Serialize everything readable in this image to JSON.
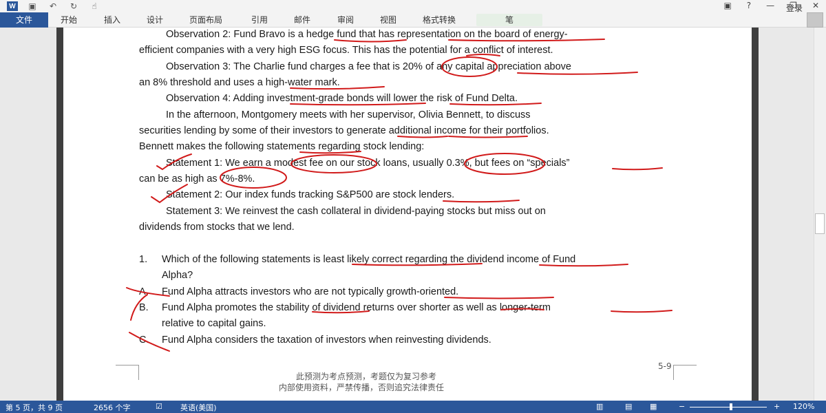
{
  "window": {
    "word_icon": "W",
    "qat_icons": [
      "save-icon",
      "undo-icon",
      "redo-icon",
      "touch-mode-icon"
    ],
    "login": "登录"
  },
  "ribbon": {
    "tabs": [
      "文件",
      "开始",
      "插入",
      "设计",
      "页面布局",
      "引用",
      "邮件",
      "审阅",
      "视图",
      "格式转换",
      "笔"
    ]
  },
  "document": {
    "lines": [
      "Observation 2: Fund Bravo is a hedge fund that has representation on the board of energy-",
      "efficient companies with a very high ESG focus. This has the potential for a conflict of interest.",
      "Observation 3: The Charlie fund charges a fee that is 20% of any capital appreciation above",
      "an 8% threshold and uses a high-water mark.",
      "Observation 4: Adding investment-grade bonds will lower the risk of Fund Delta.",
      "In the afternoon, Montgomery meets with her supervisor, Olivia Bennett, to discuss",
      "securities lending by some of their investors to generate additional income for their portfolios.",
      "Bennett makes the following statements regarding stock lending:",
      "Statement 1: We earn a modest fee on our stock loans, usually 0.3%, but fees on “specials”",
      "can be as high as 7%-8%.",
      "Statement 2: Our index funds tracking S&P500 are stock lenders.",
      "Statement 3: We reinvest the cash collateral in dividend-paying stocks but miss out on",
      "dividends from stocks that we lend."
    ],
    "question": {
      "number": "1.",
      "stem_line1": "Which of the following statements is least likely correct regarding the dividend income of Fund",
      "stem_line2": "Alpha?",
      "options": [
        {
          "letter": "A.",
          "text": "Fund Alpha attracts investors who are not typically growth-oriented."
        },
        {
          "letter": "B.",
          "text": "Fund Alpha promotes the stability of dividend returns over shorter as well as longer-term"
        },
        {
          "letter": "",
          "text": "relative to capital gains."
        },
        {
          "letter": "C.",
          "text": "Fund Alpha considers the taxation of investors when reinvesting dividends."
        }
      ]
    },
    "page_number": "5-9",
    "footer_line1": "此预测为考点预测，考题仅为复习参考",
    "footer_line2": "内部使用资料，严禁传播，否则追究法律责任"
  },
  "status": {
    "page": "第 5 页，共 9 页",
    "words": "2656 个字",
    "language": "英语(美国)",
    "zoom": "120%",
    "zoom_minus": "−",
    "zoom_plus": "+"
  },
  "colors": {
    "accent": "#2b579a",
    "ink": "#d11a1a"
  }
}
